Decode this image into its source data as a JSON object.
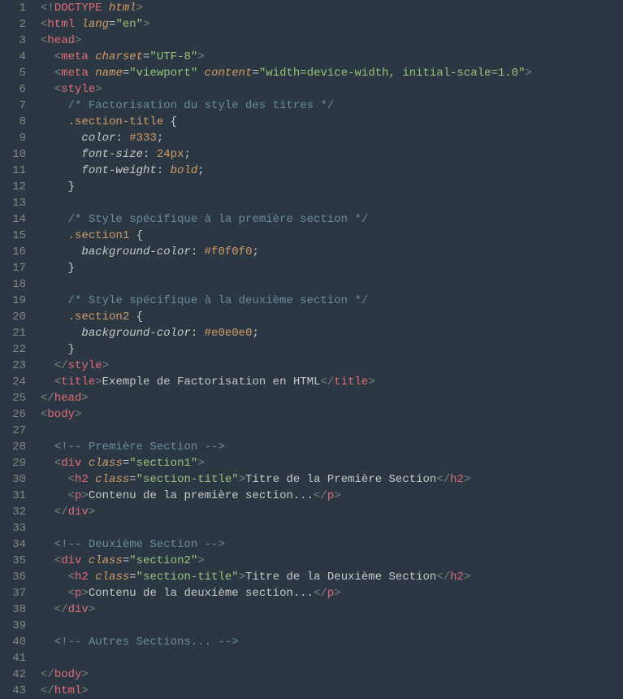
{
  "lineCount": 43,
  "lines": [
    [
      [
        "tag-bracket",
        "<!"
      ],
      [
        "doctype-kw",
        "DOCTYPE"
      ],
      [
        "text-content",
        " "
      ],
      [
        "doctype-val",
        "html"
      ],
      [
        "tag-bracket",
        ">"
      ]
    ],
    [
      [
        "tag-bracket",
        "<"
      ],
      [
        "tag-name",
        "html"
      ],
      [
        "text-content",
        " "
      ],
      [
        "attr-name",
        "lang"
      ],
      [
        "attr-eq",
        "="
      ],
      [
        "attr-val",
        "\"en\""
      ],
      [
        "tag-bracket",
        ">"
      ]
    ],
    [
      [
        "tag-bracket",
        "<"
      ],
      [
        "tag-name",
        "head"
      ],
      [
        "tag-bracket",
        ">"
      ]
    ],
    [
      [
        "text-content",
        "  "
      ],
      [
        "tag-bracket",
        "<"
      ],
      [
        "tag-name",
        "meta"
      ],
      [
        "text-content",
        " "
      ],
      [
        "attr-name",
        "charset"
      ],
      [
        "attr-eq",
        "="
      ],
      [
        "attr-val",
        "\"UTF-8\""
      ],
      [
        "tag-bracket",
        ">"
      ]
    ],
    [
      [
        "text-content",
        "  "
      ],
      [
        "tag-bracket",
        "<"
      ],
      [
        "tag-name",
        "meta"
      ],
      [
        "text-content",
        " "
      ],
      [
        "attr-name",
        "name"
      ],
      [
        "attr-eq",
        "="
      ],
      [
        "attr-val",
        "\"viewport\""
      ],
      [
        "text-content",
        " "
      ],
      [
        "attr-name",
        "content"
      ],
      [
        "attr-eq",
        "="
      ],
      [
        "attr-val",
        "\"width=device-width, initial-scale=1.0\""
      ],
      [
        "tag-bracket",
        ">"
      ]
    ],
    [
      [
        "text-content",
        "  "
      ],
      [
        "tag-bracket",
        "<"
      ],
      [
        "tag-name",
        "style"
      ],
      [
        "tag-bracket",
        ">"
      ]
    ],
    [
      [
        "text-content",
        "    "
      ],
      [
        "comment",
        "/* Factorisation du style des titres */"
      ]
    ],
    [
      [
        "text-content",
        "    "
      ],
      [
        "css-selector",
        ".section-title"
      ],
      [
        "text-content",
        " "
      ],
      [
        "css-brace",
        "{"
      ]
    ],
    [
      [
        "text-content",
        "      "
      ],
      [
        "css-prop",
        "color"
      ],
      [
        "css-colon",
        ": "
      ],
      [
        "css-val-hex",
        "#333"
      ],
      [
        "css-semi",
        ";"
      ]
    ],
    [
      [
        "text-content",
        "      "
      ],
      [
        "css-prop",
        "font-size"
      ],
      [
        "css-colon",
        ": "
      ],
      [
        "css-val-num",
        "24px"
      ],
      [
        "css-semi",
        ";"
      ]
    ],
    [
      [
        "text-content",
        "      "
      ],
      [
        "css-prop",
        "font-weight"
      ],
      [
        "css-colon",
        ": "
      ],
      [
        "css-val-kw",
        "bold"
      ],
      [
        "css-semi",
        ";"
      ]
    ],
    [
      [
        "text-content",
        "    "
      ],
      [
        "css-brace",
        "}"
      ]
    ],
    [
      [
        "text-content",
        ""
      ]
    ],
    [
      [
        "text-content",
        "    "
      ],
      [
        "comment",
        "/* Style spécifique à la première section */"
      ]
    ],
    [
      [
        "text-content",
        "    "
      ],
      [
        "css-selector",
        ".section1"
      ],
      [
        "text-content",
        " "
      ],
      [
        "css-brace",
        "{"
      ]
    ],
    [
      [
        "text-content",
        "      "
      ],
      [
        "css-prop",
        "background-color"
      ],
      [
        "css-colon",
        ": "
      ],
      [
        "css-val-hex",
        "#f0f0f0"
      ],
      [
        "css-semi",
        ";"
      ]
    ],
    [
      [
        "text-content",
        "    "
      ],
      [
        "css-brace",
        "}"
      ]
    ],
    [
      [
        "text-content",
        ""
      ]
    ],
    [
      [
        "text-content",
        "    "
      ],
      [
        "comment",
        "/* Style spécifique à la deuxième section */"
      ]
    ],
    [
      [
        "text-content",
        "    "
      ],
      [
        "css-selector",
        ".section2"
      ],
      [
        "text-content",
        " "
      ],
      [
        "css-brace",
        "{"
      ]
    ],
    [
      [
        "text-content",
        "      "
      ],
      [
        "css-prop",
        "background-color"
      ],
      [
        "css-colon",
        ": "
      ],
      [
        "css-val-hex",
        "#e0e0e0"
      ],
      [
        "css-semi",
        ";"
      ]
    ],
    [
      [
        "text-content",
        "    "
      ],
      [
        "css-brace",
        "}"
      ]
    ],
    [
      [
        "text-content",
        "  "
      ],
      [
        "tag-bracket",
        "</"
      ],
      [
        "tag-name",
        "style"
      ],
      [
        "tag-bracket",
        ">"
      ]
    ],
    [
      [
        "text-content",
        "  "
      ],
      [
        "tag-bracket",
        "<"
      ],
      [
        "tag-name",
        "title"
      ],
      [
        "tag-bracket",
        ">"
      ],
      [
        "text-content",
        "Exemple de Factorisation en HTML"
      ],
      [
        "tag-bracket",
        "</"
      ],
      [
        "tag-name",
        "title"
      ],
      [
        "tag-bracket",
        ">"
      ]
    ],
    [
      [
        "tag-bracket",
        "</"
      ],
      [
        "tag-name",
        "head"
      ],
      [
        "tag-bracket",
        ">"
      ]
    ],
    [
      [
        "tag-bracket",
        "<"
      ],
      [
        "tag-name",
        "body"
      ],
      [
        "tag-bracket",
        ">"
      ]
    ],
    [
      [
        "text-content",
        ""
      ]
    ],
    [
      [
        "text-content",
        "  "
      ],
      [
        "comment",
        "<!-- Première Section -->"
      ]
    ],
    [
      [
        "text-content",
        "  "
      ],
      [
        "tag-bracket",
        "<"
      ],
      [
        "tag-name",
        "div"
      ],
      [
        "text-content",
        " "
      ],
      [
        "attr-name",
        "class"
      ],
      [
        "attr-eq",
        "="
      ],
      [
        "attr-val",
        "\"section1\""
      ],
      [
        "tag-bracket",
        ">"
      ]
    ],
    [
      [
        "text-content",
        "    "
      ],
      [
        "tag-bracket",
        "<"
      ],
      [
        "tag-name",
        "h2"
      ],
      [
        "text-content",
        " "
      ],
      [
        "attr-name",
        "class"
      ],
      [
        "attr-eq",
        "="
      ],
      [
        "attr-val",
        "\"section-title\""
      ],
      [
        "tag-bracket",
        ">"
      ],
      [
        "text-content",
        "Titre de la Première Section"
      ],
      [
        "tag-bracket",
        "</"
      ],
      [
        "tag-name",
        "h2"
      ],
      [
        "tag-bracket",
        ">"
      ]
    ],
    [
      [
        "text-content",
        "    "
      ],
      [
        "tag-bracket",
        "<"
      ],
      [
        "tag-name",
        "p"
      ],
      [
        "tag-bracket",
        ">"
      ],
      [
        "text-content",
        "Contenu de la première section..."
      ],
      [
        "tag-bracket",
        "</"
      ],
      [
        "tag-name",
        "p"
      ],
      [
        "tag-bracket",
        ">"
      ]
    ],
    [
      [
        "text-content",
        "  "
      ],
      [
        "tag-bracket",
        "</"
      ],
      [
        "tag-name",
        "div"
      ],
      [
        "tag-bracket",
        ">"
      ]
    ],
    [
      [
        "text-content",
        ""
      ]
    ],
    [
      [
        "text-content",
        "  "
      ],
      [
        "comment",
        "<!-- Deuxième Section -->"
      ]
    ],
    [
      [
        "text-content",
        "  "
      ],
      [
        "tag-bracket",
        "<"
      ],
      [
        "tag-name",
        "div"
      ],
      [
        "text-content",
        " "
      ],
      [
        "attr-name",
        "class"
      ],
      [
        "attr-eq",
        "="
      ],
      [
        "attr-val",
        "\"section2\""
      ],
      [
        "tag-bracket",
        ">"
      ]
    ],
    [
      [
        "text-content",
        "    "
      ],
      [
        "tag-bracket",
        "<"
      ],
      [
        "tag-name",
        "h2"
      ],
      [
        "text-content",
        " "
      ],
      [
        "attr-name",
        "class"
      ],
      [
        "attr-eq",
        "="
      ],
      [
        "attr-val",
        "\"section-title\""
      ],
      [
        "tag-bracket",
        ">"
      ],
      [
        "text-content",
        "Titre de la Deuxième Section"
      ],
      [
        "tag-bracket",
        "</"
      ],
      [
        "tag-name",
        "h2"
      ],
      [
        "tag-bracket",
        ">"
      ]
    ],
    [
      [
        "text-content",
        "    "
      ],
      [
        "tag-bracket",
        "<"
      ],
      [
        "tag-name",
        "p"
      ],
      [
        "tag-bracket",
        ">"
      ],
      [
        "text-content",
        "Contenu de la deuxième section..."
      ],
      [
        "tag-bracket",
        "</"
      ],
      [
        "tag-name",
        "p"
      ],
      [
        "tag-bracket",
        ">"
      ]
    ],
    [
      [
        "text-content",
        "  "
      ],
      [
        "tag-bracket",
        "</"
      ],
      [
        "tag-name",
        "div"
      ],
      [
        "tag-bracket",
        ">"
      ]
    ],
    [
      [
        "text-content",
        ""
      ]
    ],
    [
      [
        "text-content",
        "  "
      ],
      [
        "comment",
        "<!-- Autres Sections... -->"
      ]
    ],
    [
      [
        "text-content",
        ""
      ]
    ],
    [
      [
        "tag-bracket",
        "</"
      ],
      [
        "tag-name",
        "body"
      ],
      [
        "tag-bracket",
        ">"
      ]
    ],
    [
      [
        "tag-bracket",
        "</"
      ],
      [
        "tag-name",
        "html"
      ],
      [
        "tag-bracket",
        ">"
      ]
    ]
  ]
}
